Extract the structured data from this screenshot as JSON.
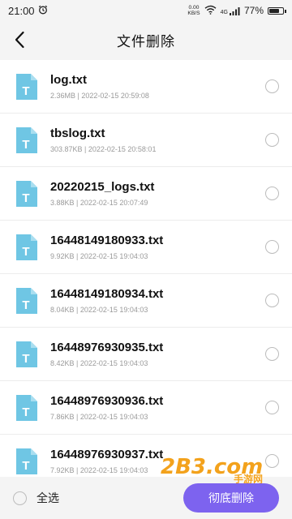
{
  "status": {
    "time": "21:00",
    "net_speed_value": "0.00",
    "net_speed_unit": "KB/S",
    "signal": "4G",
    "battery": "77%",
    "battery_level": 0.77
  },
  "header": {
    "title": "文件删除"
  },
  "files": [
    {
      "name": "log.txt",
      "info": "2.36MB | 2022-02-15 20:59:08"
    },
    {
      "name": "tbslog.txt",
      "info": "303.87KB | 2022-02-15 20:58:01"
    },
    {
      "name": "20220215_logs.txt",
      "info": "3.88KB | 2022-02-15 20:07:49"
    },
    {
      "name": "16448149180933.txt",
      "info": "9.92KB | 2022-02-15 19:04:03"
    },
    {
      "name": "16448149180934.txt",
      "info": "8.04KB | 2022-02-15 19:04:03"
    },
    {
      "name": "16448976930935.txt",
      "info": "8.42KB | 2022-02-15 19:04:03"
    },
    {
      "name": "16448976930936.txt",
      "info": "7.86KB | 2022-02-15 19:04:03"
    },
    {
      "name": "16448976930937.txt",
      "info": "7.92KB | 2022-02-15 19:04:03"
    }
  ],
  "file_icon_letter": "T",
  "footer": {
    "select_all": "全选",
    "delete_label": "彻底删除"
  },
  "watermark": {
    "text": "2B3.com",
    "sub": "手游网"
  },
  "colors": {
    "accent": "#7d63ef",
    "file_icon": "#6fc6e4",
    "background": "#f4f4f4"
  }
}
